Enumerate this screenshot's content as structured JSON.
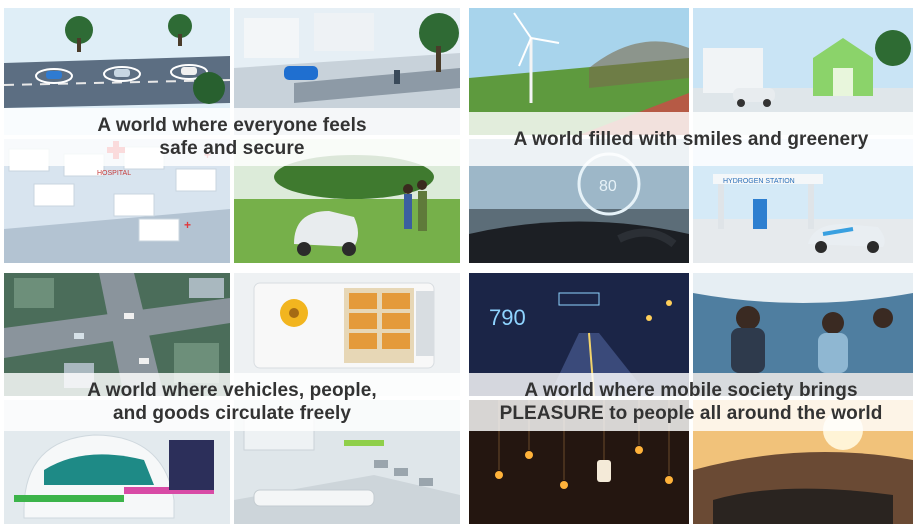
{
  "panels": [
    {
      "caption_lines": [
        "A world where everyone feels",
        "safe and secure"
      ],
      "tiles": [
        "autonomous-road-icon",
        "car-street-icon",
        "hospital-network-icon",
        "personal-mobility-icon"
      ],
      "tile_labels": [
        "HOSPITAL"
      ]
    },
    {
      "caption_lines": [
        "A world filled with smiles and greenery"
      ],
      "tiles": [
        "wind-turbine-icon",
        "green-house-car-icon",
        "dashboard-speed-icon",
        "hydrogen-station-icon"
      ],
      "tile_labels": [
        "80",
        "HYDROGEN STATION"
      ]
    },
    {
      "caption_lines": [
        "A world where vehicles, people,",
        "and goods circulate freely"
      ],
      "tiles": [
        "city-intersection-icon",
        "delivery-vehicle-icon",
        "pod-vehicle-icon",
        "transit-hub-icon"
      ],
      "tile_labels": []
    },
    {
      "caption_lines": [
        "A world where mobile society brings",
        "PLEASURE to people all around the world"
      ],
      "tiles": [
        "night-drive-hud-icon",
        "car-cabin-people-icon",
        "lanterns-night-icon",
        "convertible-sunset-icon"
      ],
      "tile_labels": [
        "790"
      ]
    }
  ],
  "colors": {
    "caption_text": "#333333",
    "caption_band": "#ffffff",
    "sky": "#cfe6f5",
    "grass": "#6fb043",
    "night": "#1a1f3a"
  }
}
